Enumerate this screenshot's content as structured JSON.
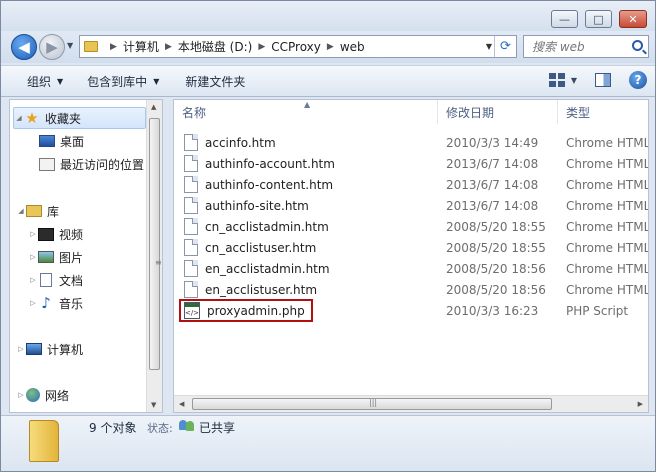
{
  "window": {
    "controls": {
      "minimize": "—",
      "maximize": "□",
      "close": "✕"
    }
  },
  "nav": {
    "breadcrumbs": [
      "计算机",
      "本地磁盘 (D:)",
      "CCProxy",
      "web"
    ],
    "search_placeholder": "搜索 web"
  },
  "toolbar": {
    "organize": "组织",
    "include_in_library": "包含到库中",
    "new_folder": "新建文件夹"
  },
  "sidebar": {
    "favorites": "收藏夹",
    "desktop": "桌面",
    "recent": "最近访问的位置",
    "libraries": "库",
    "videos": "视频",
    "pictures": "图片",
    "documents": "文档",
    "music": "音乐",
    "computer": "计算机",
    "network": "网络"
  },
  "columns": {
    "name": "名称",
    "date": "修改日期",
    "type": "类型"
  },
  "files": [
    {
      "name": "accinfo.htm",
      "date": "2010/3/3 14:49",
      "type": "Chrome HTML"
    },
    {
      "name": "authinfo-account.htm",
      "date": "2013/6/7 14:08",
      "type": "Chrome HTML"
    },
    {
      "name": "authinfo-content.htm",
      "date": "2013/6/7 14:08",
      "type": "Chrome HTML"
    },
    {
      "name": "authinfo-site.htm",
      "date": "2013/6/7 14:08",
      "type": "Chrome HTML"
    },
    {
      "name": "cn_acclistadmin.htm",
      "date": "2008/5/20 18:55",
      "type": "Chrome HTML"
    },
    {
      "name": "cn_acclistuser.htm",
      "date": "2008/5/20 18:55",
      "type": "Chrome HTML"
    },
    {
      "name": "en_acclistadmin.htm",
      "date": "2008/5/20 18:56",
      "type": "Chrome HTML"
    },
    {
      "name": "en_acclistuser.htm",
      "date": "2008/5/20 18:56",
      "type": "Chrome HTML"
    },
    {
      "name": "proxyadmin.php",
      "date": "2010/3/3 16:23",
      "type": "PHP Script"
    }
  ],
  "status": {
    "count": "9 个对象",
    "state_label": "状态:",
    "state_value": "已共享"
  },
  "icons": {
    "favorites": "star-icon",
    "desktop": "desktop-icon",
    "recent": "recent-places-icon",
    "libraries": "library-icon",
    "videos": "video-icon",
    "pictures": "picture-icon",
    "documents": "document-icon",
    "music": "music-icon",
    "computer": "computer-icon",
    "network": "network-icon",
    "htm_file": "html-file-icon",
    "php_file": "php-file-icon"
  },
  "colors": {
    "highlight_border": "#b01010",
    "column_header_text": "#4d6082",
    "secondary_text": "#6d6d6d"
  }
}
